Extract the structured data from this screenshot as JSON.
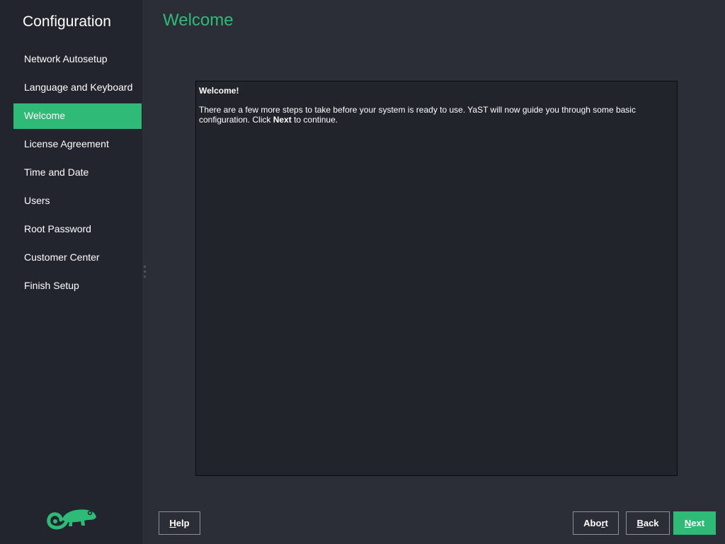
{
  "sidebar": {
    "title": "Configuration",
    "steps": [
      {
        "label": "Network Autosetup"
      },
      {
        "label": "Language and Keyboard"
      },
      {
        "label": "Welcome"
      },
      {
        "label": "License Agreement"
      },
      {
        "label": "Time and Date"
      },
      {
        "label": "Users"
      },
      {
        "label": "Root Password"
      },
      {
        "label": "Customer Center"
      },
      {
        "label": "Finish Setup"
      }
    ],
    "active_step": "Welcome",
    "logo_icon": "chameleon-logo-icon"
  },
  "page": {
    "title": "Welcome"
  },
  "content": {
    "heading": "Welcome!",
    "body_part1": "There are a few more steps to take before your system is ready to use. YaST will now guide you through some basic configuration. Click ",
    "body_bold": "Next",
    "body_part2": " to continue."
  },
  "buttons": {
    "help": {
      "mnemonic": "H",
      "rest": "elp"
    },
    "abort": {
      "pre": "Abo",
      "mnemonic": "r",
      "rest": "t"
    },
    "back": {
      "mnemonic": "B",
      "rest": "ack"
    },
    "next": {
      "mnemonic": "N",
      "rest": "ext"
    }
  },
  "colors": {
    "accent": "#30ba78",
    "sidebar_bg": "#22252d",
    "main_bg": "#2c2e37"
  }
}
